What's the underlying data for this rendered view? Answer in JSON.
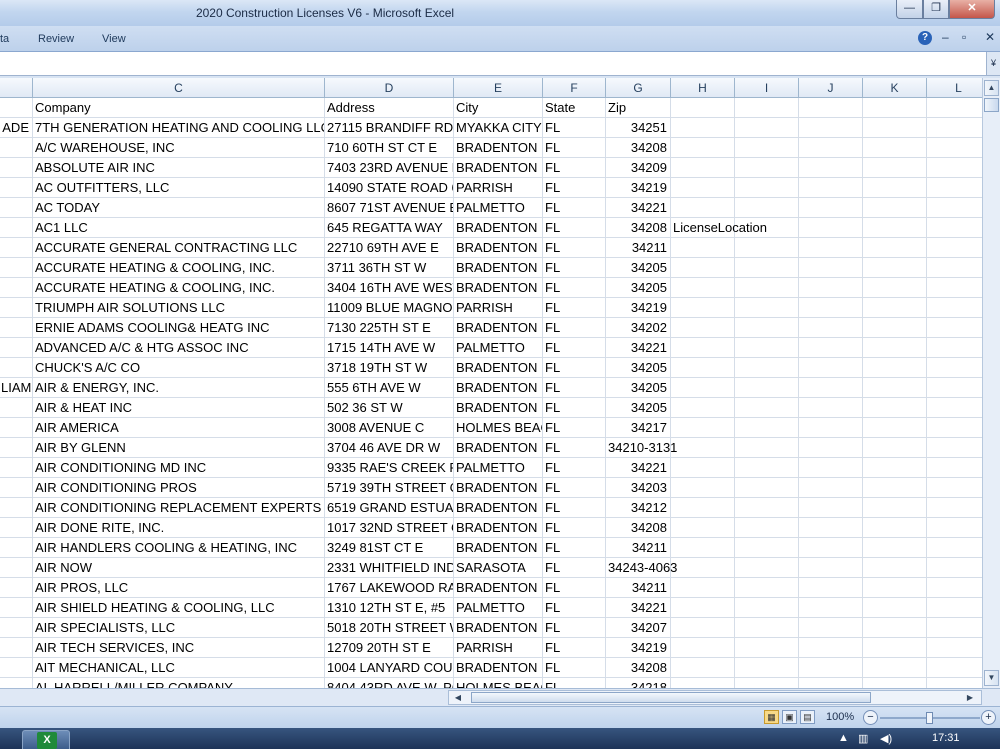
{
  "window": {
    "title": "2020 Construction Licenses V6  -  Microsoft Excel",
    "min_label": "—",
    "max_label": "❐",
    "close_label": "✕"
  },
  "ribbon": {
    "tabs": [
      "ta",
      "Review",
      "View"
    ],
    "help_label": "?",
    "min_label": "–",
    "restore_label": "▫",
    "close_label": "✕"
  },
  "formula_bar": {
    "expand_label": "¥"
  },
  "columns": [
    "",
    "C",
    "D",
    "E",
    "F",
    "G",
    "H",
    "I",
    "J",
    "K",
    "L"
  ],
  "rows": [
    {
      "b": "",
      "c": "Company",
      "d": "Address",
      "e": "City",
      "f": "State",
      "g": "Zip",
      "h": "",
      "hdr": true
    },
    {
      "b": "ADE",
      "c": "7TH GENERATION HEATING AND COOLING LLC",
      "d": "27115 BRANDIFF RD",
      "e": "MYAKKA CITY",
      "f": "FL",
      "g": "34251",
      "h": ""
    },
    {
      "b": "",
      "c": "A/C WAREHOUSE, INC",
      "d": "710 60TH ST CT E",
      "e": "BRADENTON",
      "f": "FL",
      "g": "34208",
      "h": ""
    },
    {
      "b": "",
      "c": "ABSOLUTE AIR INC",
      "d": "7403 23RD AVENUE D",
      "e": "BRADENTON",
      "f": "FL",
      "g": "34209",
      "h": ""
    },
    {
      "b": "",
      "c": "AC OUTFITTERS, LLC",
      "d": "14090 STATE ROAD 6.",
      "e": "PARRISH",
      "f": "FL",
      "g": "34219",
      "h": ""
    },
    {
      "b": "",
      "c": "AC TODAY",
      "d": "8607 71ST AVENUE E/",
      "e": "PALMETTO",
      "f": "FL",
      "g": "34221",
      "h": ""
    },
    {
      "b": "",
      "c": "AC1 LLC",
      "d": "645 REGATTA WAY",
      "e": "BRADENTON",
      "f": "FL",
      "g": "34208",
      "h": "LicenseLocation"
    },
    {
      "b": "",
      "c": "ACCURATE GENERAL CONTRACTING LLC",
      "d": "22710 69TH AVE E",
      "e": "BRADENTON",
      "f": "FL",
      "g": "34211",
      "h": ""
    },
    {
      "b": "",
      "c": "ACCURATE HEATING & COOLING, INC.",
      "d": "3711 36TH ST W",
      "e": "BRADENTON",
      "f": "FL",
      "g": "34205",
      "h": ""
    },
    {
      "b": "",
      "c": "ACCURATE HEATING & COOLING, INC.",
      "d": "3404 16TH AVE WEST",
      "e": "BRADENTON",
      "f": "FL",
      "g": "34205",
      "h": ""
    },
    {
      "b": "",
      "c": "TRIUMPH AIR SOLUTIONS LLC",
      "d": "11009 BLUE MAGNOL",
      "e": "PARRISH",
      "f": "FL",
      "g": "34219",
      "h": ""
    },
    {
      "b": "",
      "c": "ERNIE ADAMS COOLING& HEATG INC",
      "d": "7130 225TH ST E",
      "e": "BRADENTON",
      "f": "FL",
      "g": "34202",
      "h": ""
    },
    {
      "b": "",
      "c": "ADVANCED A/C & HTG ASSOC INC",
      "d": "1715 14TH AVE W",
      "e": "PALMETTO",
      "f": "FL",
      "g": "34221",
      "h": ""
    },
    {
      "b": "",
      "c": "CHUCK'S A/C CO",
      "d": "3718 19TH ST W",
      "e": "BRADENTON",
      "f": "FL",
      "g": "34205",
      "h": ""
    },
    {
      "b": "LIAM",
      "c": "AIR & ENERGY, INC.",
      "d": "555 6TH AVE W",
      "e": "BRADENTON",
      "f": "FL",
      "g": "34205",
      "h": ""
    },
    {
      "b": "",
      "c": "AIR & HEAT INC",
      "d": "502 36 ST W",
      "e": "BRADENTON",
      "f": "FL",
      "g": "34205",
      "h": ""
    },
    {
      "b": "",
      "c": "AIR AMERICA",
      "d": "3008 AVENUE C",
      "e": "HOLMES BEAC",
      "f": "FL",
      "g": "34217",
      "h": ""
    },
    {
      "b": "",
      "c": "AIR BY GLENN",
      "d": "3704 46 AVE DR W",
      "e": "BRADENTON",
      "f": "FL",
      "g": "34210-3131",
      "h": "",
      "gtext": true
    },
    {
      "b": "",
      "c": "AIR CONDITIONING MD INC",
      "d": "9335 RAE'S CREEK PL/",
      "e": "PALMETTO",
      "f": "FL",
      "g": "34221",
      "h": ""
    },
    {
      "b": "",
      "c": "AIR CONDITIONING PROS",
      "d": "5719 39TH STREET CIF",
      "e": "BRADENTON",
      "f": "FL",
      "g": "34203",
      "h": ""
    },
    {
      "b": "",
      "c": "AIR CONDITIONING REPLACEMENT EXPERTS",
      "d": "6519 GRAND ESTUAR",
      "e": "BRADENTON",
      "f": "FL",
      "g": "34212",
      "h": ""
    },
    {
      "b": "",
      "c": "AIR DONE RITE, INC.",
      "d": "1017 32ND STREET CC",
      "e": "BRADENTON",
      "f": "FL",
      "g": "34208",
      "h": ""
    },
    {
      "b": "",
      "c": "AIR HANDLERS COOLING & HEATING, INC",
      "d": "3249 81ST CT E",
      "e": "BRADENTON",
      "f": "FL",
      "g": "34211",
      "h": ""
    },
    {
      "b": "",
      "c": "AIR NOW",
      "d": "2331 WHITFIELD INDI",
      "e": "SARASOTA",
      "f": "FL",
      "g": "34243-4063",
      "h": "",
      "gtext": true
    },
    {
      "b": "",
      "c": "AIR PROS, LLC",
      "d": "1767 LAKEWOOD RAI",
      "e": "BRADENTON",
      "f": "FL",
      "g": "34211",
      "h": ""
    },
    {
      "b": "",
      "c": "AIR SHIELD HEATING & COOLING, LLC",
      "d": "1310 12TH ST E, #5",
      "e": "PALMETTO",
      "f": "FL",
      "g": "34221",
      "h": ""
    },
    {
      "b": "",
      "c": "AIR SPECIALISTS, LLC",
      "d": "5018 20TH STREET W",
      "e": "BRADENTON",
      "f": "FL",
      "g": "34207",
      "h": ""
    },
    {
      "b": "",
      "c": "AIR TECH SERVICES, INC",
      "d": "12709 20TH ST E",
      "e": "PARRISH",
      "f": "FL",
      "g": "34219",
      "h": ""
    },
    {
      "b": "",
      "c": "AIT MECHANICAL, LLC",
      "d": "1004 LANYARD COUR",
      "e": "BRADENTON",
      "f": "FL",
      "g": "34208",
      "h": ""
    },
    {
      "b": "",
      "c": "AL HARRELL/MILLER COMPANY",
      "d": "8404 43RD AVE W, PC",
      "e": "HOLMES BEAC",
      "f": "FL",
      "g": "34218",
      "h": ""
    }
  ],
  "status_bar": {
    "zoom": "100%",
    "zoom_out_label": "−",
    "zoom_in_label": "+"
  },
  "taskbar": {
    "excel_label": "X",
    "time": "17:31"
  }
}
